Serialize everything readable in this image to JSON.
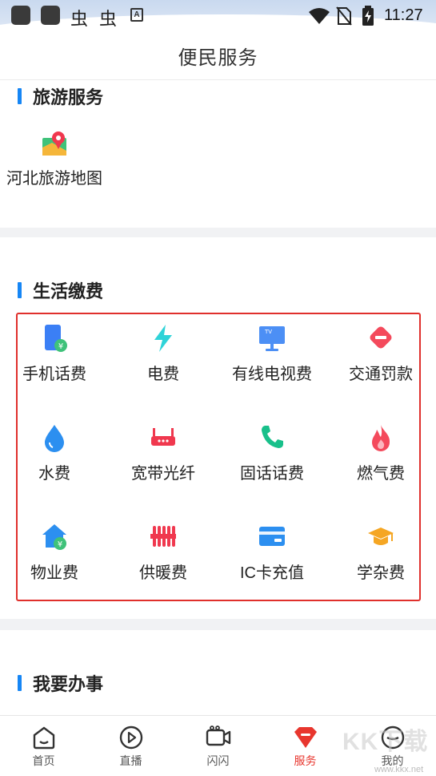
{
  "status_bar": {
    "time": "11:27",
    "bug_glyph": "虫",
    "a_glyph": "A"
  },
  "header": {
    "title": "便民服务"
  },
  "travel": {
    "title": "旅游服务",
    "items": [
      {
        "label": "河北旅游地图",
        "icon": "map-pin-icon"
      }
    ]
  },
  "living": {
    "title": "生活缴费",
    "items": [
      {
        "label": "手机话费",
        "icon": "phone-bill-icon"
      },
      {
        "label": "电费",
        "icon": "lightning-icon"
      },
      {
        "label": "有线电视费",
        "icon": "tv-icon"
      },
      {
        "label": "交通罚款",
        "icon": "traffic-fine-icon"
      },
      {
        "label": "水费",
        "icon": "water-drop-icon"
      },
      {
        "label": "宽带光纤",
        "icon": "router-icon"
      },
      {
        "label": "固话话费",
        "icon": "telephone-icon"
      },
      {
        "label": "燃气费",
        "icon": "flame-icon"
      },
      {
        "label": "物业费",
        "icon": "house-icon"
      },
      {
        "label": "供暖费",
        "icon": "radiator-icon"
      },
      {
        "label": "IC卡充值",
        "icon": "card-icon"
      },
      {
        "label": "学杂费",
        "icon": "graduation-cap-icon"
      }
    ]
  },
  "affairs": {
    "title": "我要办事"
  },
  "nav": {
    "items": [
      {
        "label": "首页",
        "icon": "home-icon"
      },
      {
        "label": "直播",
        "icon": "play-icon"
      },
      {
        "label": "闪闪",
        "icon": "video-camera-icon"
      },
      {
        "label": "服务",
        "icon": "service-icon",
        "active": true
      },
      {
        "label": "我的",
        "icon": "user-icon"
      }
    ]
  },
  "watermark": {
    "main": "KK下载",
    "url": "www.kkx.net"
  },
  "colors": {
    "accent": "#1686f5",
    "active": "#e8362e",
    "highlight_box": "#e0302c"
  }
}
